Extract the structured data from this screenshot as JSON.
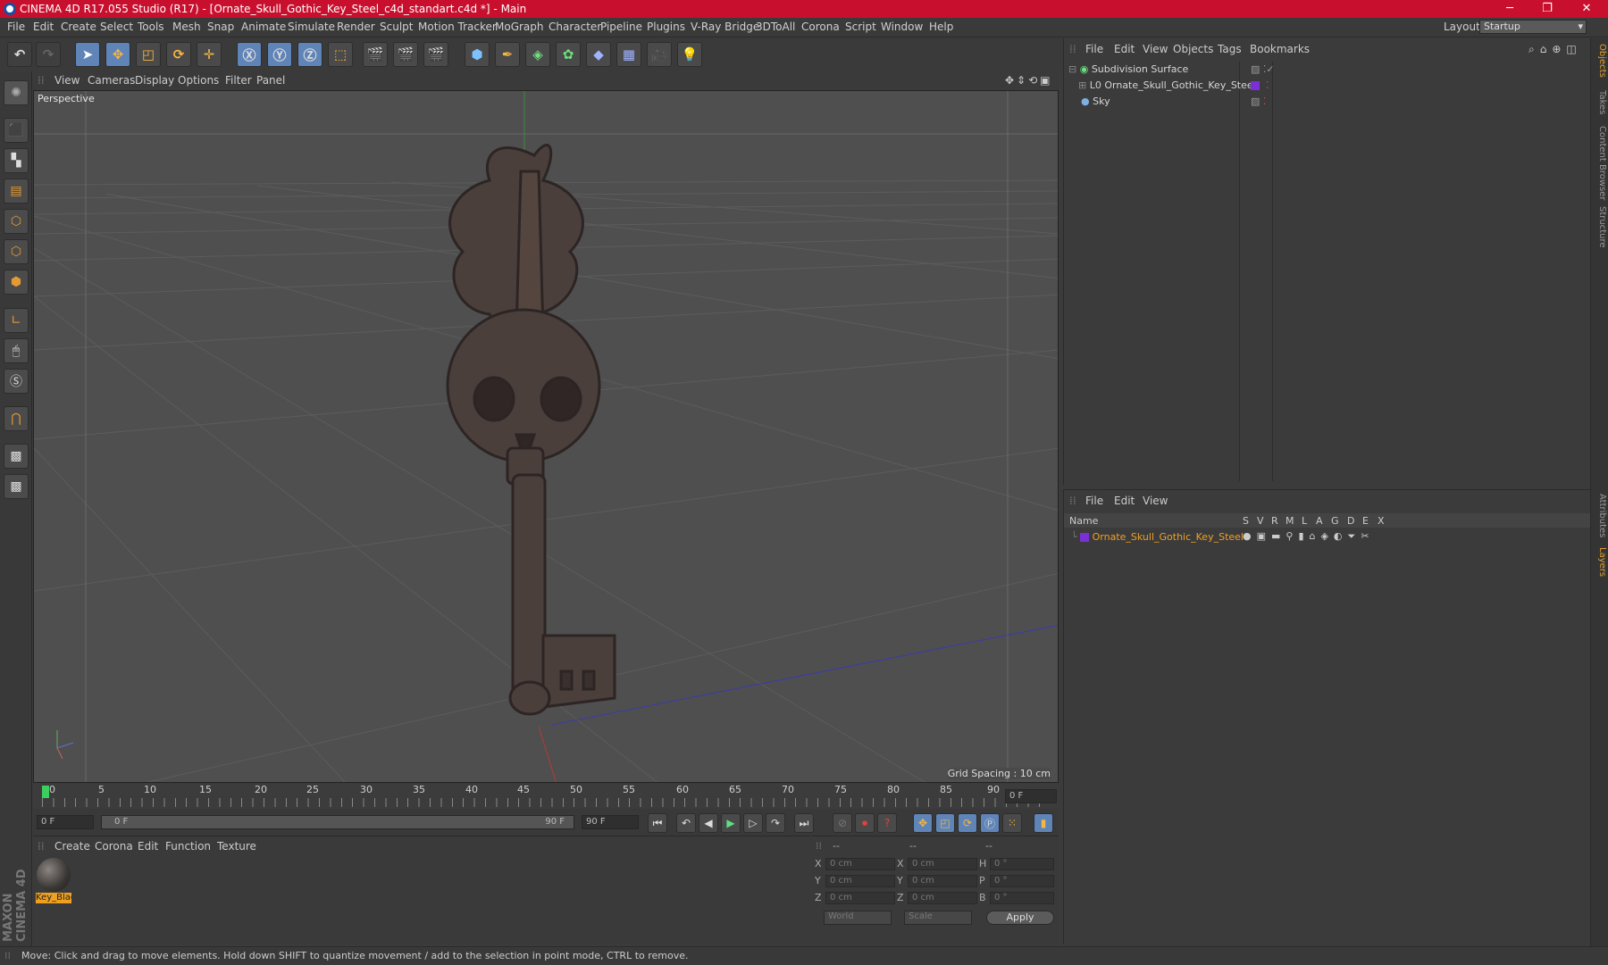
{
  "window": {
    "title": "CINEMA 4D R17.055 Studio (R17) - [Ornate_Skull_Gothic_Key_Steel_c4d_standart.c4d *] - Main",
    "minimize": "─",
    "maximize": "❐",
    "close": "✕"
  },
  "menubar": {
    "items": [
      "File",
      "Edit",
      "Create",
      "Select",
      "Tools",
      "Mesh",
      "Snap",
      "Animate",
      "Simulate",
      "Render",
      "Sculpt",
      "Motion Tracker",
      "MoGraph",
      "Character",
      "Pipeline",
      "Plugins",
      "V-Ray Bridge",
      "3DToAll",
      "Corona",
      "Script",
      "Window",
      "Help"
    ],
    "layout_label": "Layout:",
    "layout_value": "Startup"
  },
  "viewport": {
    "menu": [
      "View",
      "Cameras",
      "Display",
      "Options",
      "Filter",
      "Panel"
    ],
    "camera_label": "Perspective",
    "grid_spacing": "Grid Spacing : 10 cm"
  },
  "timeline": {
    "ticks": [
      "0",
      "5",
      "10",
      "15",
      "20",
      "25",
      "30",
      "35",
      "40",
      "45",
      "50",
      "55",
      "60",
      "65",
      "70",
      "75",
      "80",
      "85",
      "90"
    ],
    "current_frame": "0 F",
    "start_field": "0 F",
    "range_start": "0 F",
    "range_end": "90 F",
    "end_field": "90 F"
  },
  "material_manager": {
    "menu": [
      "Create",
      "Corona",
      "Edit",
      "Function",
      "Texture"
    ],
    "materials": [
      {
        "name": "Key_Blac"
      }
    ]
  },
  "coordinates": {
    "headers": [
      "--",
      "--",
      "--"
    ],
    "rows": [
      {
        "a": "X",
        "av": "0 cm",
        "b": "X",
        "bv": "0 cm",
        "c": "H",
        "cv": "0 °"
      },
      {
        "a": "Y",
        "av": "0 cm",
        "b": "Y",
        "bv": "0 cm",
        "c": "P",
        "cv": "0 °"
      },
      {
        "a": "Z",
        "av": "0 cm",
        "b": "Z",
        "bv": "0 cm",
        "c": "B",
        "cv": "0 °"
      }
    ],
    "space": "World",
    "mode": "Scale",
    "apply": "Apply"
  },
  "object_manager": {
    "menu": [
      "File",
      "Edit",
      "View",
      "Objects",
      "Tags",
      "Bookmarks"
    ],
    "objects": [
      {
        "name": "Subdivision Surface"
      },
      {
        "name": "Ornate_Skull_Gothic_Key_Steel"
      },
      {
        "name": "Sky"
      }
    ]
  },
  "layer_manager": {
    "menu": [
      "File",
      "Edit",
      "View"
    ],
    "header_name": "Name",
    "columns": [
      "S",
      "V",
      "R",
      "M",
      "L",
      "A",
      "G",
      "D",
      "E",
      "X"
    ],
    "layers": [
      {
        "name": "Ornate_Skull_Gothic_Key_Steel",
        "color": "#7b2fd6"
      }
    ]
  },
  "right_tabs": [
    "Objects",
    "Takes",
    "Content Browser",
    "Structure",
    "Attributes",
    "Layers"
  ],
  "status": "Move: Click and drag to move elements. Hold down SHIFT to quantize movement / add to the selection in point mode, CTRL to remove.",
  "brand": "MAXON CINEMA 4D",
  "colors": {
    "accent": "#5f84b8",
    "title": "#c8102e",
    "layer_text": "#f0a020"
  }
}
